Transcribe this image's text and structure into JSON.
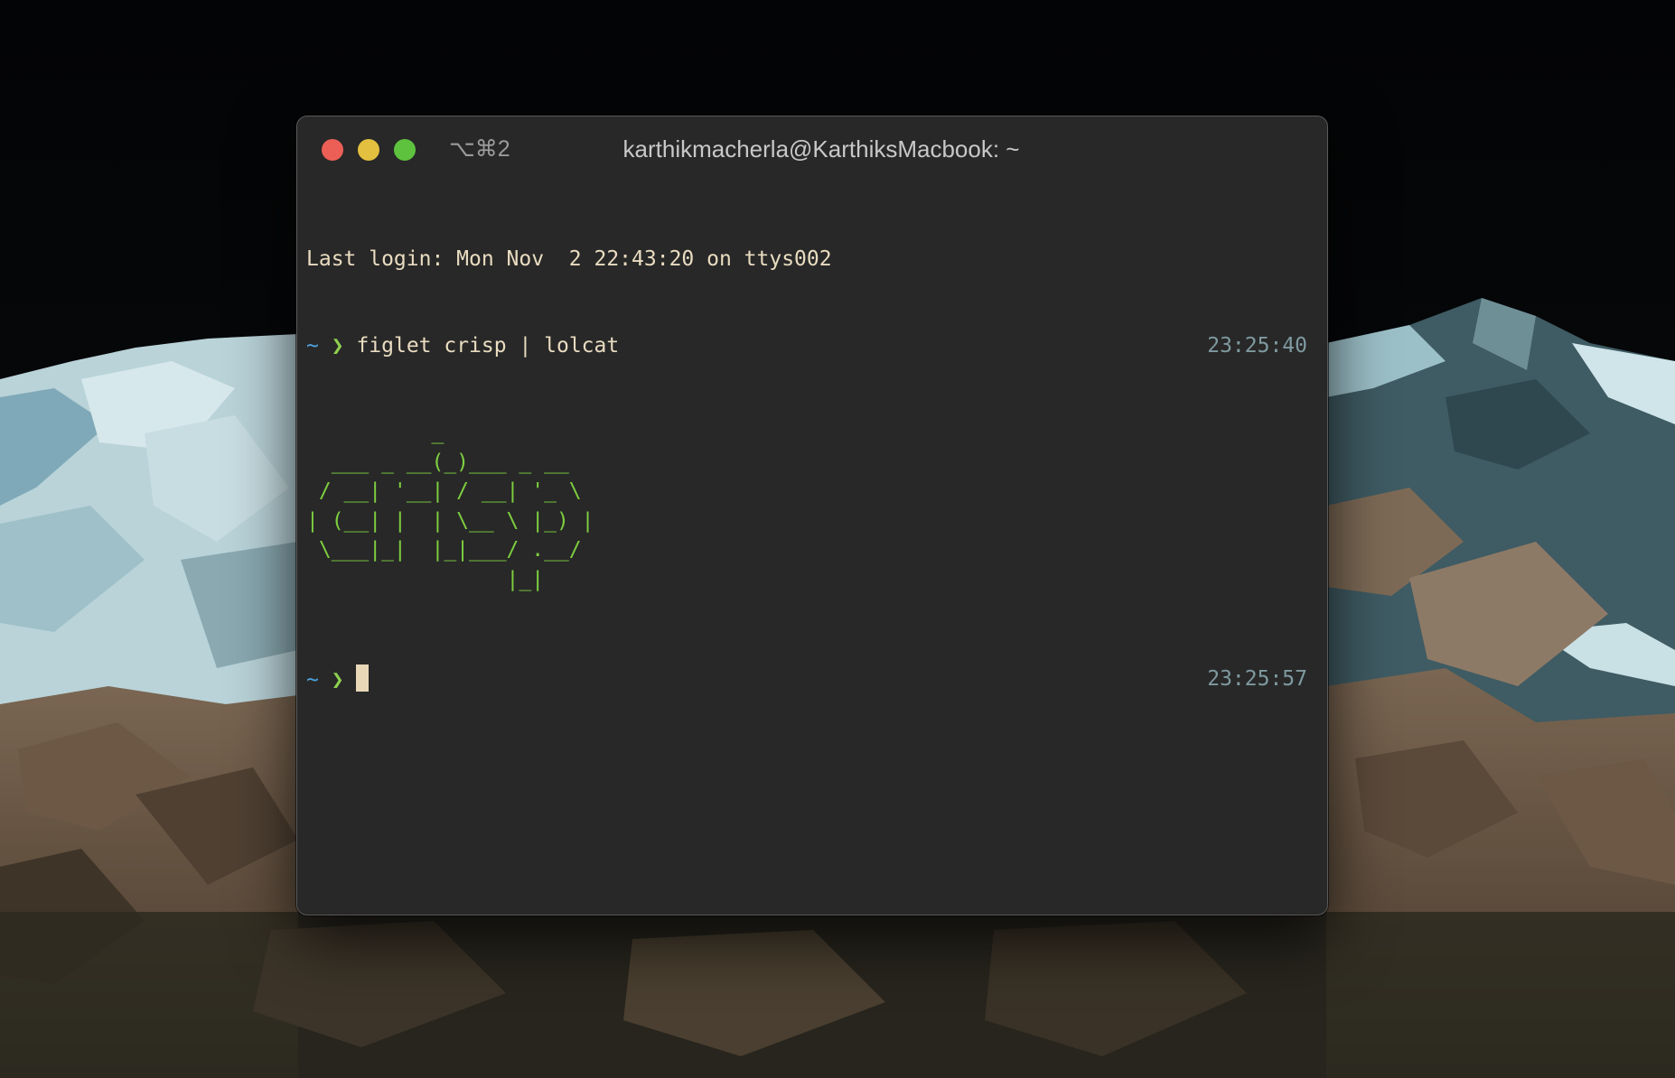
{
  "window": {
    "shortcut": "⌥⌘2",
    "title": "karthikmacherla@KarthiksMacbook: ~"
  },
  "colors": {
    "close": "#ec5f57",
    "minimize": "#e3c03f",
    "maximize": "#5ec23f",
    "ascii_art": "#7dcf3f",
    "prompt_tilde": "#4fa3df",
    "prompt_arrow": "#8fd14f"
  },
  "terminal": {
    "last_login": "Last login: Mon Nov  2 22:43:20 on ttys002",
    "prompt_tilde": "~",
    "prompt_arrow": "❯",
    "command1": "figlet crisp | lolcat",
    "time1": "23:25:40",
    "ascii_art": "          _           \n  ___ _ __(_)___ _ __  \n / __| '__| / __| '_ \\ \n| (__| |  | \\__ \\ |_) |\n \\___|_|  |_|___/ .__/ \n                |_|    ",
    "time2": "23:25:57"
  }
}
